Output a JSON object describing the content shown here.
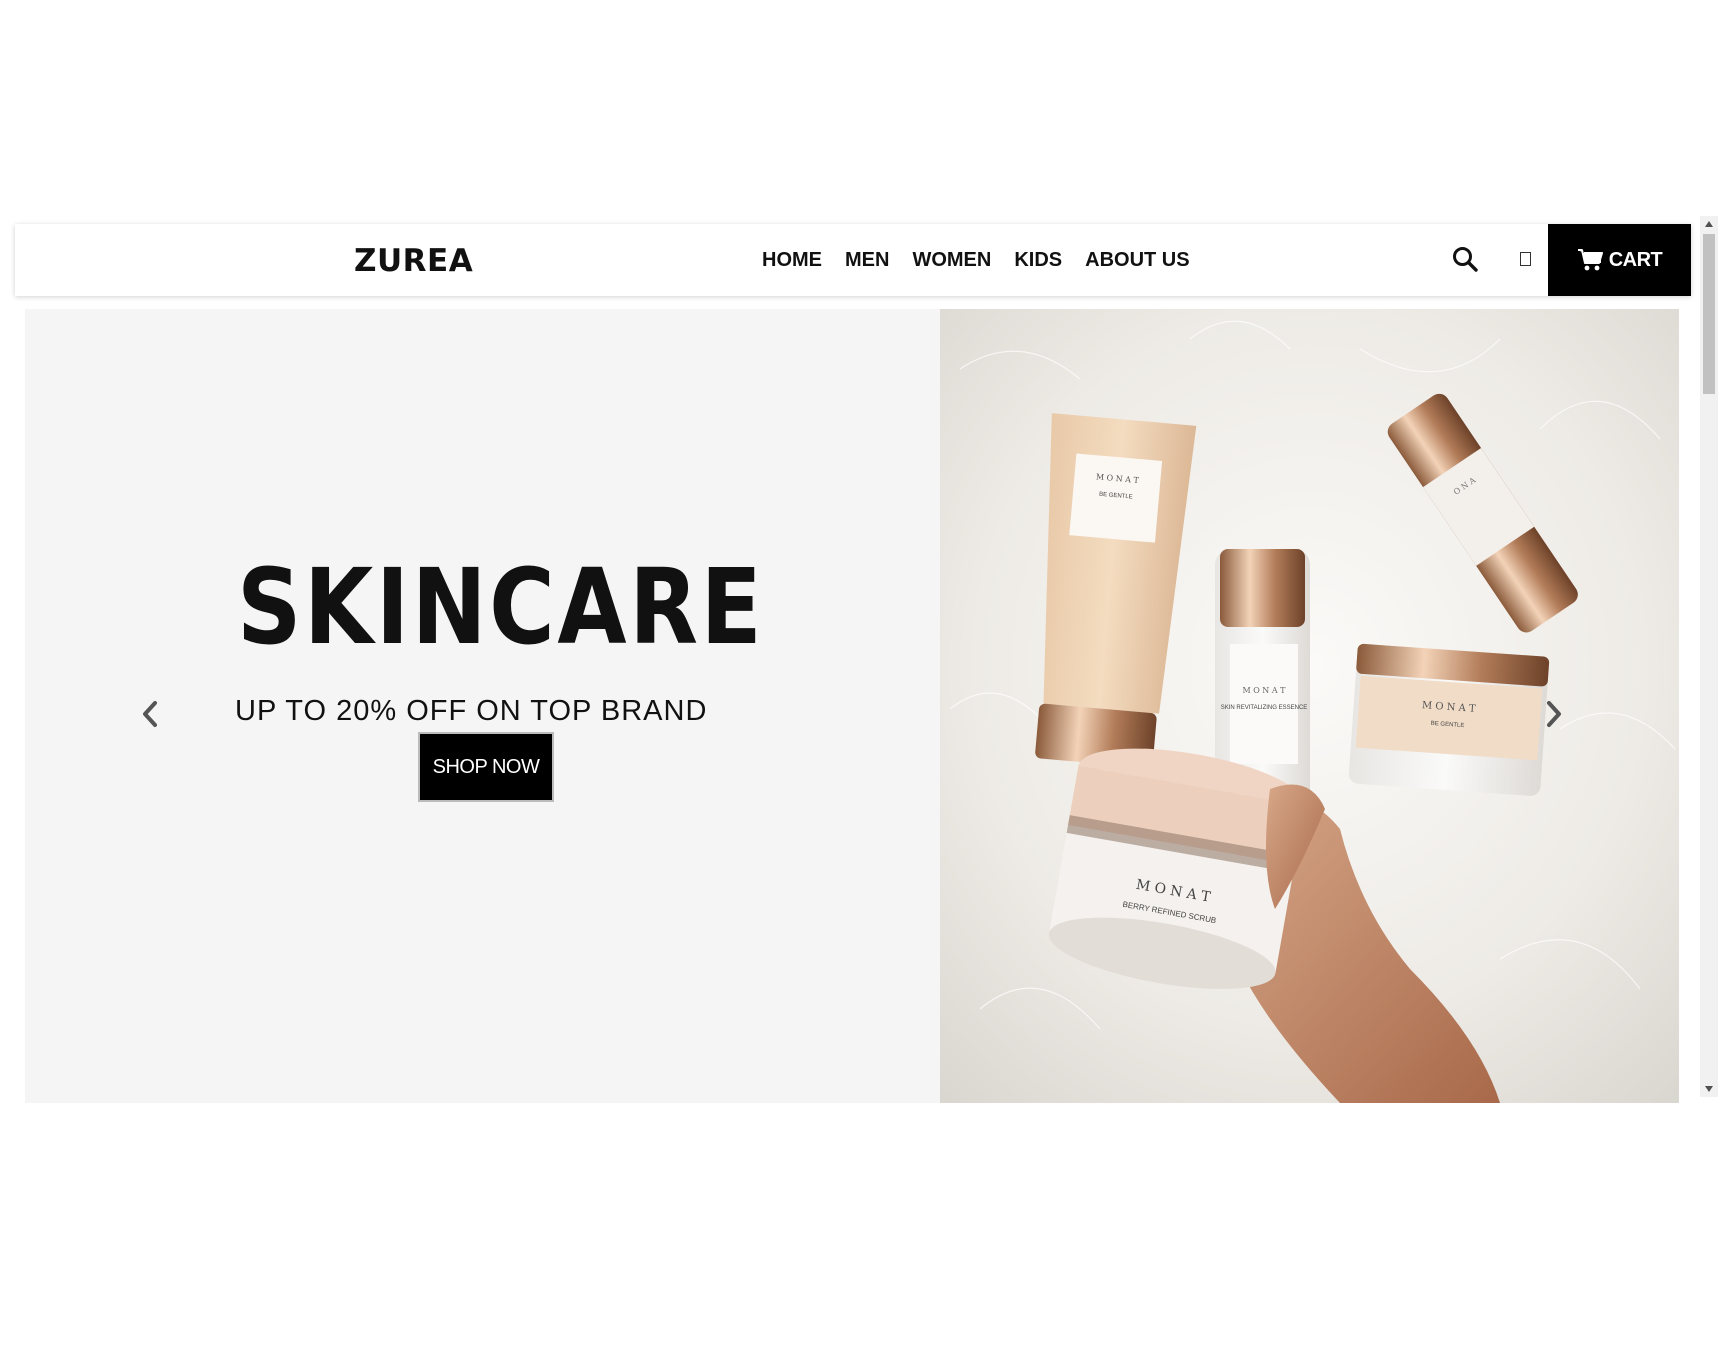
{
  "header": {
    "logo": "ZUREA",
    "nav": [
      "HOME",
      "MEN",
      "WOMEN",
      "KIDS",
      "ABOUT US"
    ],
    "search_icon": "search-icon",
    "user_icon": "user-icon",
    "cart_label": "CART",
    "cart_icon": "cart-icon"
  },
  "hero": {
    "title": "SKINCARE",
    "subtitle": "UP TO 20% OFF ON TOP BRAND",
    "button_label": "SHOP NOW",
    "prev_icon": "chevron-left-icon",
    "next_icon": "chevron-right-icon",
    "product_labels": {
      "tube_brand": "M O N A T",
      "tube_name": "BE GENTLE",
      "bottle_brand": "M O N A T",
      "bottle_name": "SKIN REVITALIZING ESSENCE",
      "jar_right_brand": "M O N A T",
      "jar_right_name": "BE GENTLE",
      "jar_front_brand": "M O N A T",
      "jar_front_name": "BERRY REFINED SCRUB",
      "serum_brand": "O N A"
    }
  },
  "colors": {
    "accent": "#000000",
    "hero_bg": "#f5f5f5",
    "text": "#111111"
  }
}
